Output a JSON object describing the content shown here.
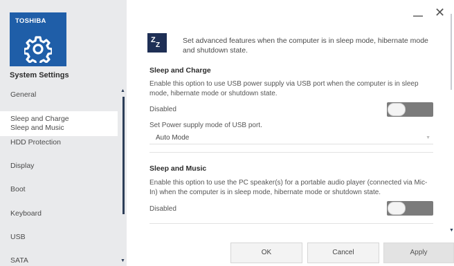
{
  "sidebar": {
    "brand": "TOSHIBA",
    "title": "System Settings",
    "items": [
      {
        "label": "General"
      },
      {
        "label": "Sleep and Charge",
        "sublabel": "Sleep and Music"
      },
      {
        "label": "HDD Protection"
      },
      {
        "label": "Display"
      },
      {
        "label": "Boot"
      },
      {
        "label": "Keyboard"
      },
      {
        "label": "USB"
      },
      {
        "label": "SATA"
      }
    ],
    "scroll_up_glyph": "▲",
    "scroll_down_glyph": "▼"
  },
  "window": {
    "minimize_glyph": "—",
    "close_glyph": "✕"
  },
  "header": {
    "icon": "sleep-zz-icon",
    "icon_glyph_1": "Z",
    "icon_glyph_2": "Z",
    "text": "Set advanced features when the computer is in sleep mode, hibernate mode and shutdown state."
  },
  "sleep_and_charge": {
    "title": "Sleep and Charge",
    "description": "Enable this option to use USB power supply via USB port when the computer is in sleep mode, hibernate mode or shutdown state.",
    "state_label": "Disabled",
    "enabled": false,
    "power_mode_label": "Set Power supply mode of USB port.",
    "power_mode_value": "Auto Mode"
  },
  "sleep_and_music": {
    "title": "Sleep and Music",
    "description": "Enable this option to use the PC speaker(s) for a portable audio player (connected via Mic-In) when the computer is in sleep mode, hibernate mode or shutdown state.",
    "state_label": "Disabled",
    "enabled": false
  },
  "buttons": {
    "ok": "OK",
    "cancel": "Cancel",
    "apply": "Apply"
  },
  "colors": {
    "brand_blue": "#1f5ea8",
    "sidebar_bg": "#e9eaec",
    "toggle_off": "#7b7b7b",
    "header_icon_bg": "#1e2f55"
  }
}
